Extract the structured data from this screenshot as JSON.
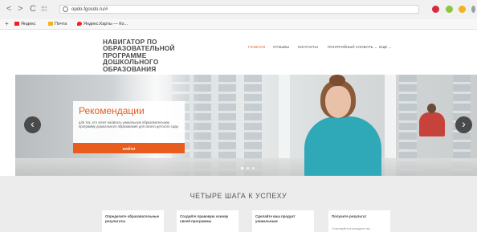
{
  "browser": {
    "back_label": "<",
    "forward_label": ">",
    "reload_label": "C",
    "apps_label": "⁞⁞⁞",
    "url": "opdo-fgosdo.ru/#",
    "new_tab_label": "+",
    "bookmarks": [
      {
        "label": "Яндекс",
        "color": "#e22"
      },
      {
        "label": "Почта",
        "color": "#f2b31b"
      },
      {
        "label": "Яндекс.Карты — Ко...",
        "color": "#e22"
      }
    ]
  },
  "site": {
    "logo_lines": [
      "НАВИГАТОР ПО",
      "ОБРАЗОВАТЕЛЬНОЙ",
      "ПРОГРАММЕ",
      "ДОШКОЛЬНОГО",
      "ОБРАЗОВАНИЯ"
    ],
    "menu": [
      {
        "label": "ГЛАВНАЯ",
        "active": true
      },
      {
        "label": "ОТЗЫВЫ",
        "active": false
      },
      {
        "label": "КОНТАКТЫ",
        "active": false
      },
      {
        "label": "ПОНЯТИЙНЫЙ СЛОВАРЬ ⌄",
        "active": false
      },
      {
        "label": "ЕЩЕ ⌄",
        "active": false
      }
    ]
  },
  "hero": {
    "title": "Рекомендации",
    "description": "для тех, кто хочет написать уникальную образовательную программу дошкольного образования для своего детского сада",
    "button_label": "НАЙТИ",
    "prev_label": "‹",
    "next_label": "›",
    "slides_count": 3,
    "active_slide": 1
  },
  "steps": {
    "title": "ЧЕТЫРЕ ШАГА К УСПЕХУ",
    "items": [
      {
        "title": "Определите образовательные результаты",
        "subtitle": ""
      },
      {
        "title": "Создайте правовую основу своей программы",
        "subtitle": ""
      },
      {
        "title": "Сделайте ваш продукт уникальным",
        "subtitle": ""
      },
      {
        "title": "Получите результат",
        "subtitle": "Участвуйте в конкурсе на..."
      }
    ]
  },
  "colors": {
    "accent": "#e85c1e",
    "hero_card": "#ffffff",
    "section_bg": "#ececec"
  }
}
